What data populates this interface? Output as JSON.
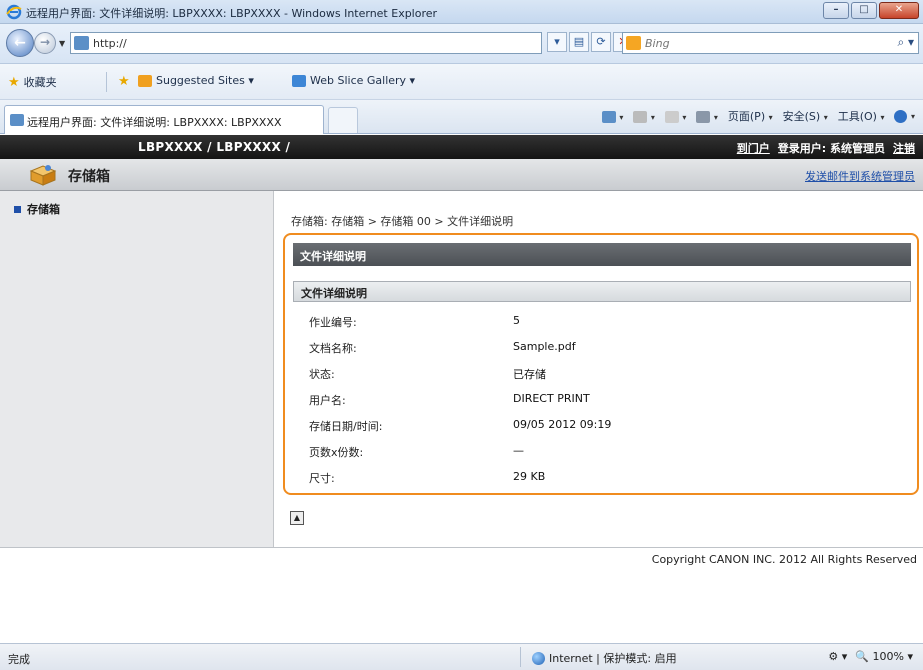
{
  "window": {
    "title": "远程用户界面: 文件详细说明: LBPXXXX: LBPXXXX - Windows Internet Explorer",
    "minimize": "–",
    "maximize": "□",
    "close": "✕"
  },
  "address": {
    "url": "http://",
    "search_placeholder": "Bing"
  },
  "favorites": {
    "label": "收藏夹",
    "suggested": "Suggested Sites ▾",
    "webslice": "Web Slice Gallery ▾"
  },
  "tab": {
    "label": "远程用户界面: 文件详细说明: LBPXXXX: LBPXXXX"
  },
  "commands": {
    "page": "页面(P)",
    "safety": "安全(S)",
    "tools": "工具(O)"
  },
  "header": {
    "model": "LBPXXXX / LBPXXXX /",
    "portal_link": "到门户",
    "login_user": "登录用户: 系统管理员",
    "logout_link": "注销",
    "section_title": "存储箱",
    "mail_link": "发送邮件到系统管理员"
  },
  "sidebar": {
    "items": [
      {
        "label": "存储箱"
      }
    ]
  },
  "main": {
    "breadcrumb": "存储箱: 存储箱 > 存储箱 00 > 文件详细说明",
    "panel_title": "文件详细说明",
    "sub_title": "文件详细说明",
    "rows": [
      {
        "label": "作业编号:",
        "value": "5"
      },
      {
        "label": "文档名称:",
        "value": "Sample.pdf"
      },
      {
        "label": "状态:",
        "value": "已存储"
      },
      {
        "label": "用户名:",
        "value": "DIRECT PRINT"
      },
      {
        "label": "存储日期/时间:",
        "value": "09/05 2012 09:19"
      },
      {
        "label": "页数x份数:",
        "value": "—"
      },
      {
        "label": "尺寸:",
        "value": "29 KB"
      }
    ],
    "copyright": "Copyright CANON INC. 2012 All Rights Reserved"
  },
  "statusbar": {
    "status": "完成",
    "zone": "Internet | 保护模式: 启用",
    "zoom": "100%"
  },
  "colors": {
    "highlight_border": "#f08c1f",
    "header_dark": "#1a1a1a",
    "link": "#1f4fa8"
  }
}
